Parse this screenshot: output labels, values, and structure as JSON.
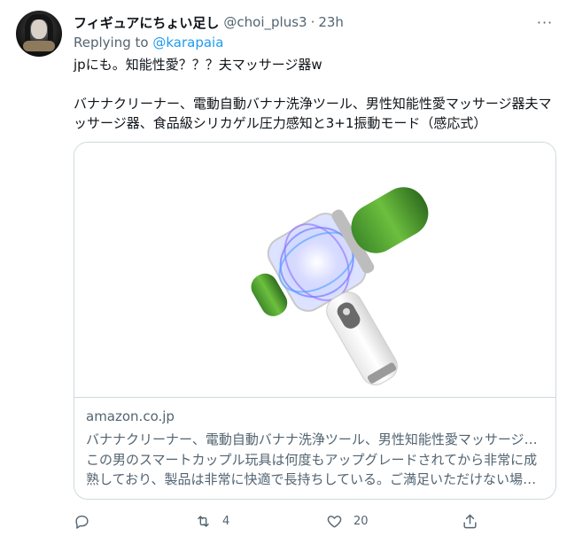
{
  "tweet": {
    "display_name": "フィギュアにちょい足し",
    "handle": "@choi_plus3",
    "separator": "·",
    "time": "23h",
    "more_label": "···",
    "replying_prefix": "Replying to",
    "replying_to": "@karapaia",
    "text_line1": "jpにも。知能性愛？？？夫マッサージ器w",
    "text_line2": "バナナクリーナー、電動自動バナナ洗浄ツール、男性知能性愛マッサージ器夫マッサージ器、食品級シリカゲル圧力感知と3+1振動モード（感応式）"
  },
  "card": {
    "domain": "amazon.co.jp",
    "title": "バナナクリーナー、電動自動バナナ洗浄ツール、男性知能性愛マッサージ器夫マッサージ器、食品級シリカゲル圧力感知と3+1振動モード（感応式）",
    "description": "この男のスマートカップル玩具は何度もアップグレードされてから非常に成熟しており、製品は非常に快適で長持ちしている。ご満足いただけない場合はご連絡ください。"
  },
  "actions": {
    "reply_count": "",
    "retweet_count": "4",
    "like_count": "20",
    "share_count": ""
  },
  "icons": {
    "reply": "reply-icon",
    "retweet": "retweet-icon",
    "like": "heart-icon",
    "share": "share-icon",
    "more": "more-icon"
  },
  "colors": {
    "accent": "#1d9bf0",
    "secondary_text": "#536471",
    "primary_text": "#0f1419",
    "border": "#cfd9de"
  }
}
